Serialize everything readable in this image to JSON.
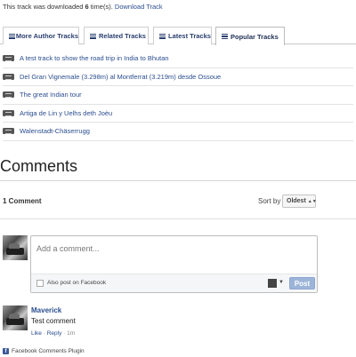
{
  "download": {
    "prefix": "This track was downloaded ",
    "count": "6",
    "suffix": " time(s).",
    "link": "Download Track"
  },
  "tabs": [
    {
      "label": "More Author Tracks",
      "icon": "list-icon",
      "active": false
    },
    {
      "label": "Related Tracks",
      "icon": "list-icon",
      "active": false
    },
    {
      "label": "Latest Tracks",
      "icon": "list-icon",
      "active": false
    },
    {
      "label": "Popular Tracks",
      "icon": "list-icon",
      "active": true
    }
  ],
  "tracks": [
    "A test track to show the road trip in India to Bhutan",
    "Del Gran Vignemale (3.298m) al Montferrat (3.219m) desde Ossoue",
    "The great Indian tour",
    "Artiga de Lin y Uelhs deth Joèu",
    "Walenstadt-Chäserrugg"
  ],
  "comments": {
    "title": "Comments",
    "count_label": "1 Comment",
    "sort_label": "Sort by",
    "sort_value": "Oldest",
    "compose": {
      "placeholder": "Add a comment...",
      "also_post": "Also post on Facebook",
      "post_button": "Post"
    },
    "items": [
      {
        "name": "Maverick",
        "text": "Test comment",
        "like": "Like",
        "separator": " · ",
        "reply": "Reply",
        "time": "1m"
      }
    ],
    "plugin_label": "Facebook Comments Plugin"
  },
  "colors": {
    "link": "#2a4d8f",
    "tab_text": "#2a3f6f",
    "post_button": "#9cb4d8",
    "facebook": "#3b5998"
  }
}
